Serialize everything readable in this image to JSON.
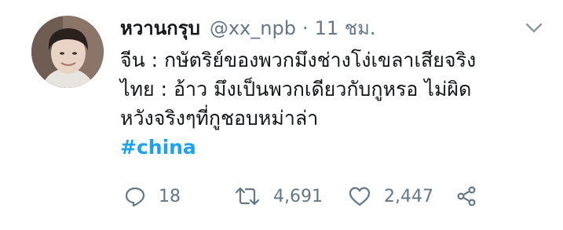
{
  "tweet": {
    "display_name": "หวานกรุบ",
    "handle": "@xx_npb",
    "separator": "·",
    "time": "11 ชม.",
    "lines": [
      "จีน : กษัตริย์ของพวกมึงช่างโง่เขลาเสียจริง",
      "ไทย : อ้าว มึงเป็นพวกเดียวกับกูหรอ ไม่ผิด",
      "หวังจริงๆที่กูชอบหม่าล่า"
    ],
    "hashtag": "#china",
    "actions": {
      "reply_count": "18",
      "retweet_count": "4,691",
      "like_count": "2,447"
    }
  },
  "colors": {
    "text": "#14171a",
    "secondary": "#657786",
    "link": "#1da1f2"
  },
  "icons": [
    "more-caret-icon",
    "reply-icon",
    "retweet-icon",
    "like-icon",
    "share-icon"
  ]
}
